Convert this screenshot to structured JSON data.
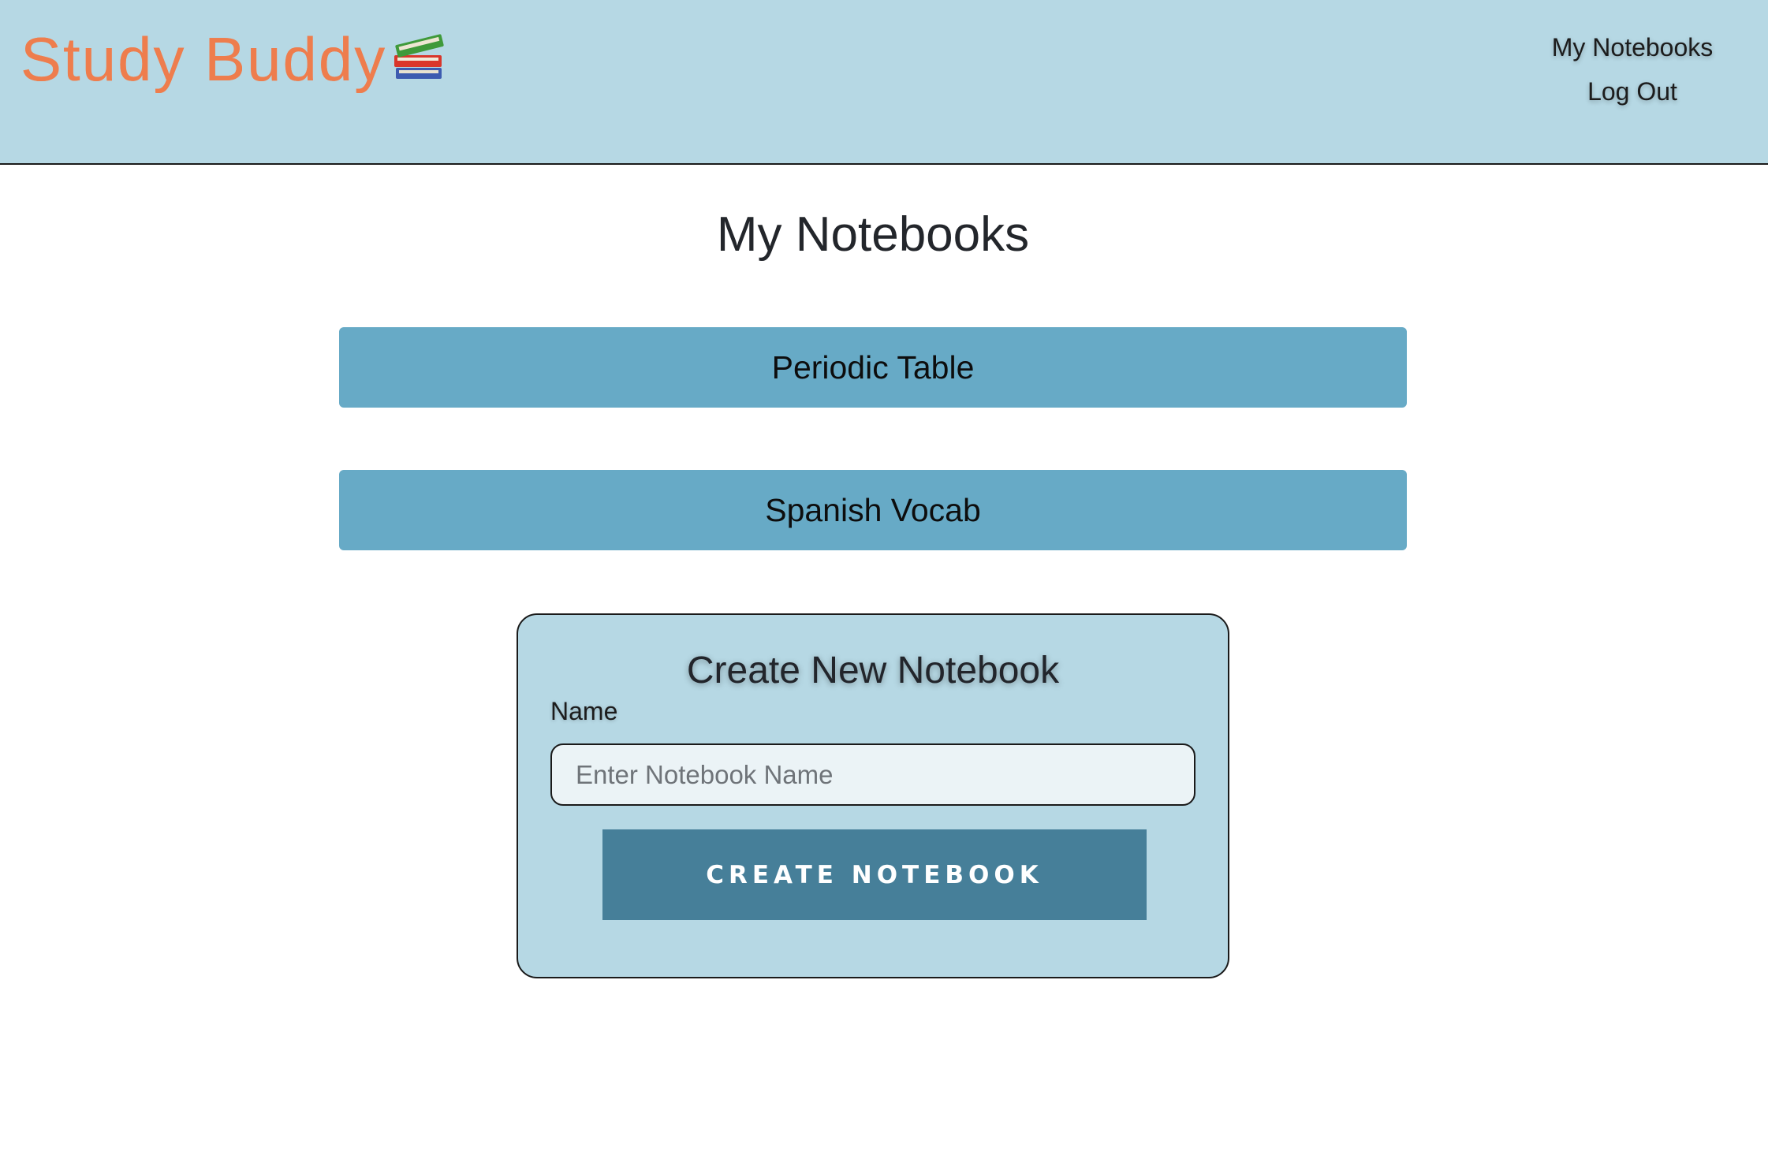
{
  "header": {
    "brand_title": "Study Buddy",
    "brand_icon": "books-icon",
    "nav": {
      "my_notebooks": "My Notebooks",
      "log_out": "Log Out"
    }
  },
  "main": {
    "title": "My Notebooks",
    "notebooks": [
      {
        "name": "Periodic Table"
      },
      {
        "name": "Spanish Vocab"
      }
    ]
  },
  "create_form": {
    "title": "Create New Notebook",
    "name_label": "Name",
    "name_value": "",
    "name_placeholder": "Enter Notebook Name",
    "submit_label": "CREATE NOTEBOOK"
  },
  "colors": {
    "header_bg": "#b6d8e4",
    "brand": "#ee7d4d",
    "notebook_bg": "#67aac6",
    "button_bg": "#467f99"
  }
}
